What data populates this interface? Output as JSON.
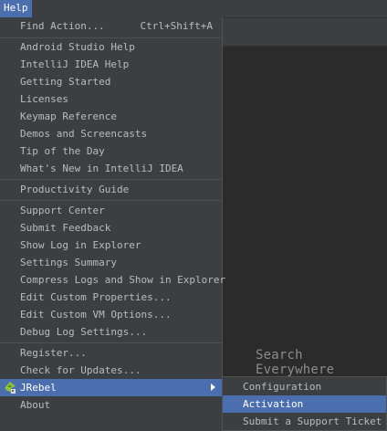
{
  "menubar": {
    "help_label": "Help"
  },
  "editor": {
    "hint": "Search Everywhere"
  },
  "menu": {
    "find_action": {
      "label": "Find Action...",
      "shortcut": "Ctrl+Shift+A"
    },
    "android_studio_help": "Android Studio Help",
    "intellij_help": "IntelliJ IDEA Help",
    "getting_started": "Getting Started",
    "licenses": "Licenses",
    "keymap_reference": "Keymap Reference",
    "demos": "Demos and Screencasts",
    "tip_of_day": "Tip of the Day",
    "whats_new": "What's New in IntelliJ IDEA",
    "productivity_guide": "Productivity Guide",
    "support_center": "Support Center",
    "submit_feedback": "Submit Feedback",
    "show_log": "Show Log in Explorer",
    "settings_summary": "Settings Summary",
    "compress_logs": "Compress Logs and Show in Explorer",
    "edit_custom_properties": "Edit Custom Properties...",
    "edit_custom_vm": "Edit Custom VM Options...",
    "debug_log_settings": "Debug Log Settings...",
    "register": "Register...",
    "check_updates": "Check for Updates...",
    "jrebel": "JRebel",
    "about": "About"
  },
  "submenu": {
    "configuration": "Configuration",
    "activation": "Activation",
    "submit_ticket": "Submit a Support Ticket"
  },
  "colors": {
    "menu_bg": "#3c3f41",
    "selection": "#4b6eaf",
    "text": "#bbbbbb",
    "separator": "#515151",
    "editor_bg": "#2b2b2b"
  }
}
